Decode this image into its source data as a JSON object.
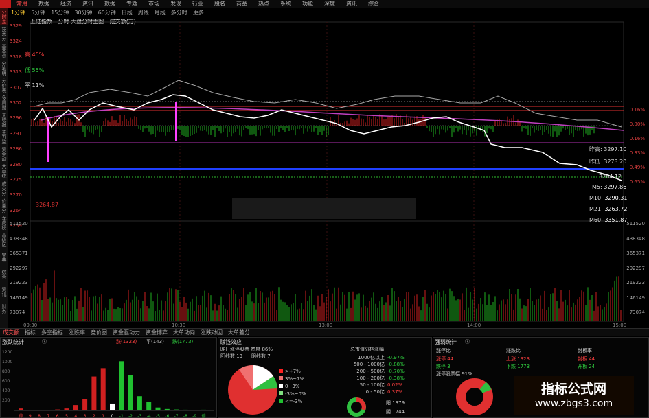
{
  "menu": {
    "items": [
      "常用",
      "数据",
      "经济",
      "资讯",
      "数据",
      "专题",
      "市场",
      "发现",
      "行业",
      "股名",
      "商品",
      "热点",
      "系统",
      "功能",
      "深度",
      "资讯",
      "综合"
    ]
  },
  "side_tabs": [
    "分时走势",
    "技术分析",
    "基本资料",
    "分笔明细",
    "分价表",
    "多周期",
    "关联报价",
    "主力监控",
    "资金动向",
    "大单统计",
    "成交分布",
    "价量分析",
    "龙虎榜",
    "高级区间",
    "宝典",
    "综合",
    "资讯",
    "财务"
  ],
  "period_bar": [
    "1分钟",
    "5分钟",
    "15分钟",
    "30分钟",
    "60分钟",
    "日线",
    "周线",
    "月线",
    "多分时",
    "更多"
  ],
  "subtitle": {
    "index_name": "上证指数",
    "mode": "分时 大盘分时主图",
    "volume_label": "成交额(万)"
  },
  "price_axis_left": [
    "3329",
    "3324",
    "3318",
    "3313",
    "3307",
    "3302",
    "3296",
    "3291",
    "3286",
    "3280",
    "3275",
    "3270",
    "3264",
    "3259"
  ],
  "price_axis_right": [
    "0.16%",
    "0.00%",
    "0.16%",
    "0.33%",
    "0.49%",
    "0.65%"
  ],
  "volume_axis_left": [
    "511520",
    "438348",
    "365371",
    "292297",
    "219223",
    "146149",
    "73074"
  ],
  "volume_axis_right": [
    "511520",
    "438348",
    "365371",
    "292297",
    "219223",
    "146149",
    "73074"
  ],
  "annotations": {
    "red_rate": "高 45%",
    "green_rate": "低 55%",
    "flat_rate": "平 11%",
    "left_low": "3264.87",
    "ma_day_high": "昨高: 3297.10",
    "ma_day_low": "昨低: 3273.20",
    "ma5": "3297.86",
    "ma10": "3290.31",
    "ma21": "3263.72",
    "ma60": "3351.87",
    "ma_last": "3264.12"
  },
  "ma_names": [
    "M5",
    "M10",
    "M21",
    "M60"
  ],
  "time_axis": [
    "09:30",
    "10:30",
    "13:00",
    "14:00",
    "15:00"
  ],
  "bottom_tabs": [
    "成交额",
    "指标",
    "多空指标",
    "涨跌率",
    "竞价图",
    "资金驱动力",
    "资金博弈",
    "大单动向",
    "涨跌动因",
    "大单差分"
  ],
  "panel_updown": {
    "title": "涨跌统计",
    "up": "涨(1323)",
    "flat": "平(143)",
    "down": "跌(1773)",
    "y_ticks": [
      "1200",
      "1000",
      "800",
      "600",
      "400",
      "200"
    ],
    "bins": [
      "停",
      "9",
      "8",
      "7",
      "6",
      "5",
      "4",
      "3",
      "2",
      "1",
      "0",
      "-1",
      "-2",
      "-3",
      "-4",
      "-5",
      "-6",
      "-7",
      "-8",
      "-9",
      "停"
    ]
  },
  "chart_data": {
    "type": "bar",
    "title": "涨跌统计",
    "categories": [
      "停",
      "9",
      "8",
      "7",
      "6",
      "5",
      "4",
      "3",
      "2",
      "1",
      "0",
      "-1",
      "-2",
      "-3",
      "-4",
      "-5",
      "-6",
      "-7",
      "-8",
      "-9",
      "停"
    ],
    "values": [
      40,
      8,
      10,
      12,
      20,
      40,
      110,
      230,
      690,
      860,
      140,
      1000,
      720,
      290,
      170,
      60,
      30,
      20,
      15,
      10,
      15
    ],
    "ylim": [
      0,
      1200
    ]
  },
  "panel_money": {
    "title": "赚钱效应",
    "yesterday_line": "昨日涨停股票 热度 86%",
    "sub1": "阳线数 13",
    "sub2": "阴线数 7",
    "legend": [
      ">+7%",
      "3%~7%",
      "0~3%",
      "-3%~0%",
      "<=-3%"
    ],
    "cap_title": "总市值分档涨幅",
    "cap_rows": [
      {
        "label": "1000亿以上",
        "value": "-0.97%"
      },
      {
        "label": "500 - 1000亿",
        "value": "-0.88%"
      },
      {
        "label": "200 - 500亿",
        "value": "-0.70%"
      },
      {
        "label": "100 - 200亿",
        "value": "-0.38%"
      },
      {
        "label": "50 - 100亿",
        "value": "0.02%"
      },
      {
        "label": "0 - 50亿",
        "value": "0.37%"
      }
    ],
    "yang": "阳 1379",
    "yin": "阴 1744"
  },
  "panel_strength": {
    "title": "强弱统计",
    "zt_title": "涨停比",
    "zt_up": "涨停 44",
    "zt_down": "跌停 3",
    "zd_title": "涨跌比",
    "zd_up": "上涨 1323",
    "zd_down": "下跌 1773",
    "fb_title": "封板率",
    "fb_up": "封板 44",
    "fb_down": "开板 24",
    "zt_rate": "涨停股票幅 91%"
  },
  "watermark": {
    "line1": "指标公式网",
    "line2": "www.zbgs3.com"
  }
}
